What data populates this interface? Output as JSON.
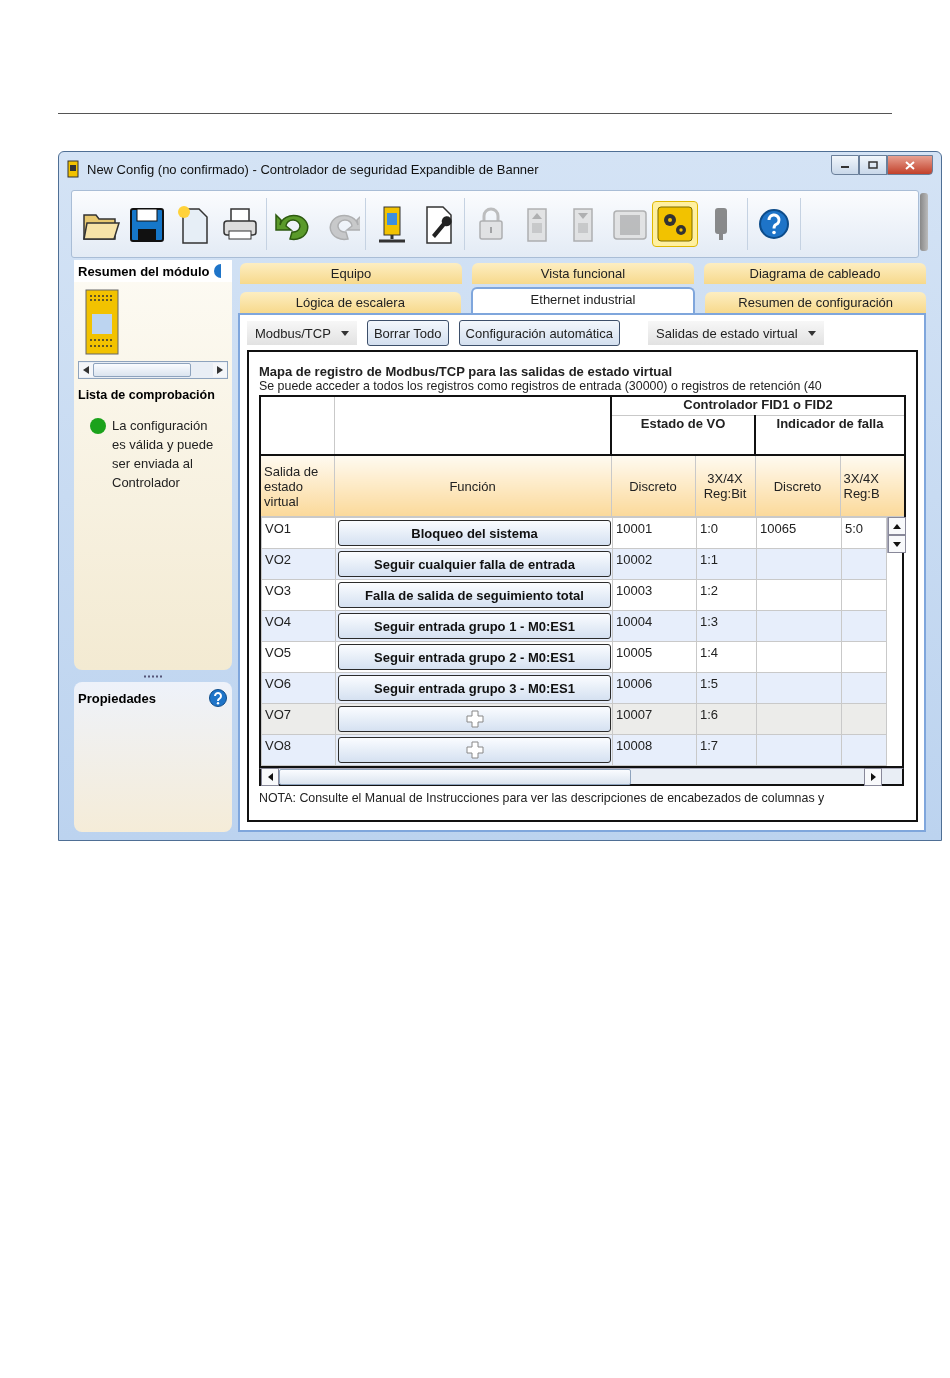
{
  "window": {
    "title": "New Config (no confirmado) - Controlador de seguridad Expandible de Banner"
  },
  "toolbar": {
    "groups": [
      {
        "buttons": [
          {
            "kind": "open",
            "disabled": false,
            "active": false
          },
          {
            "kind": "save",
            "disabled": false,
            "active": false
          },
          {
            "kind": "new",
            "disabled": false,
            "active": false
          },
          {
            "kind": "print",
            "disabled": false,
            "active": false
          }
        ]
      },
      {
        "buttons": [
          {
            "kind": "undo",
            "disabled": false,
            "active": false
          },
          {
            "kind": "redo",
            "disabled": true,
            "active": false
          }
        ]
      },
      {
        "buttons": [
          {
            "kind": "device",
            "disabled": false,
            "active": false
          },
          {
            "kind": "doc-wrench",
            "disabled": false,
            "active": false
          }
        ]
      },
      {
        "buttons": [
          {
            "kind": "lock",
            "disabled": true,
            "active": false
          },
          {
            "kind": "upload",
            "disabled": true,
            "active": false
          },
          {
            "kind": "download",
            "disabled": true,
            "active": false
          },
          {
            "kind": "chip",
            "disabled": true,
            "active": false
          },
          {
            "kind": "gears",
            "disabled": false,
            "active": true
          },
          {
            "kind": "usb",
            "disabled": true,
            "active": false
          }
        ]
      },
      {
        "buttons": [
          {
            "kind": "help",
            "disabled": false,
            "active": false
          }
        ]
      }
    ]
  },
  "module_summary": {
    "title": "Resumen del módulo"
  },
  "checklist": {
    "title": "Lista de comprobación",
    "items": [
      {
        "color": "#1ba21b",
        "text": "La configuración es válida y puede ser enviada al Controlador"
      }
    ]
  },
  "properties": {
    "title": "Propiedades"
  },
  "tab_rows": [
    {
      "tabs": [
        {
          "label": "Equipo",
          "selected": false
        },
        {
          "label": "Vista funcional",
          "selected": false
        },
        {
          "label": "Diagrama de cableado",
          "selected": false
        }
      ]
    },
    {
      "tabs": [
        {
          "label": "Lógica de escalera",
          "selected": false
        },
        {
          "label": "Ethernet industrial",
          "selected": true
        },
        {
          "label": "Resumen de configuración",
          "selected": false
        }
      ]
    }
  ],
  "ethernet": {
    "protocol": "Modbus/TCP",
    "buttons": [
      "Borrar Todo",
      "Configuración automática"
    ],
    "view": "Salidas de estado virtual",
    "map": {
      "title": "Mapa de registro de Modbus/TCP para las salidas de estado virtual",
      "subtitle": "Se puede acceder a todos los registros como registros de entrada (30000) o registros de retención (40",
      "group": "Controlador FID1 o FID2",
      "subgroups": [
        "Estado de VO",
        "Indicador de falla"
      ],
      "columns": [
        "Salida de estado virtual",
        "Función",
        "Discreto",
        "3X/4X Reg:Bit",
        "Discreto",
        "3X/4X Reg:B"
      ],
      "rows": [
        {
          "output": "VO1",
          "kind": "function",
          "function": "Bloqueo del sistema",
          "discrete": "10001",
          "reg_bit": "1:0",
          "fault_discrete": "10065",
          "fault_reg_bit": "5:0",
          "selected": false
        },
        {
          "output": "VO2",
          "kind": "function",
          "function": "Seguir cualquier falla de entrada",
          "discrete": "10002",
          "reg_bit": "1:1",
          "selected": false
        },
        {
          "output": "VO3",
          "kind": "function",
          "function": "Falla de salida de seguimiento total",
          "discrete": "10003",
          "reg_bit": "1:2",
          "selected": false
        },
        {
          "output": "VO4",
          "kind": "function",
          "function": "Seguir entrada grupo 1 - M0:ES1",
          "discrete": "10004",
          "reg_bit": "1:3",
          "selected": false
        },
        {
          "output": "VO5",
          "kind": "function",
          "function": "Seguir entrada grupo 2 - M0:ES1",
          "discrete": "10005",
          "reg_bit": "1:4",
          "selected": false
        },
        {
          "output": "VO6",
          "kind": "function",
          "function": "Seguir entrada grupo 3 - M0:ES1",
          "discrete": "10006",
          "reg_bit": "1:5",
          "selected": false
        },
        {
          "output": "VO7",
          "kind": "empty",
          "discrete": "10007",
          "reg_bit": "1:6",
          "selected": true
        },
        {
          "output": "VO8",
          "kind": "empty",
          "discrete": "10008",
          "reg_bit": "1:7",
          "selected": false
        }
      ],
      "note": "NOTA: Consulte el Manual de Instrucciones para ver las descripciones de encabezados de columnas y"
    }
  }
}
